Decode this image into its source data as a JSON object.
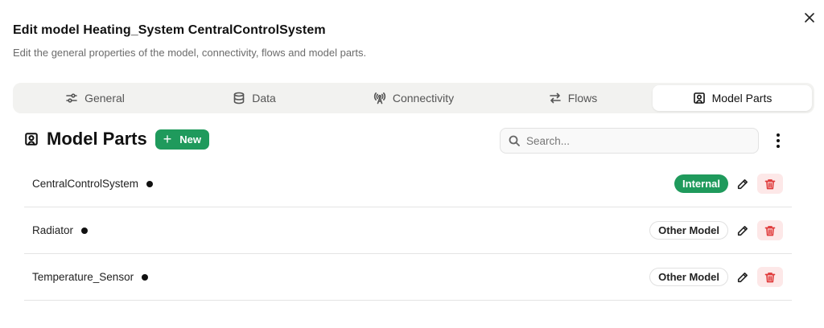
{
  "dialog": {
    "title": "Edit model Heating_System CentralControlSystem",
    "subtitle": "Edit the general properties of the model, connectivity, flows and model parts.",
    "close_icon": "close-icon"
  },
  "tabs": [
    {
      "label": "General",
      "icon": "sliders-icon",
      "active": false
    },
    {
      "label": "Data",
      "icon": "database-icon",
      "active": false
    },
    {
      "label": "Connectivity",
      "icon": "antenna-icon",
      "active": false
    },
    {
      "label": "Flows",
      "icon": "arrows-left-right-icon",
      "active": false
    },
    {
      "label": "Model Parts",
      "icon": "user-square-icon",
      "active": true
    }
  ],
  "section": {
    "title": "Model Parts",
    "icon": "user-square-icon",
    "new_label": "New"
  },
  "search": {
    "placeholder": "Search..."
  },
  "parts": [
    {
      "name": "CentralControlSystem",
      "badge": "Internal",
      "badge_type": "internal"
    },
    {
      "name": "Radiator",
      "badge": "Other Model",
      "badge_type": "other"
    },
    {
      "name": "Temperature_Sensor",
      "badge": "Other Model",
      "badge_type": "other"
    }
  ],
  "colors": {
    "accent_green": "#1f9a5c",
    "delete_red": "#e03b3b",
    "delete_bg": "#fde8e8"
  }
}
